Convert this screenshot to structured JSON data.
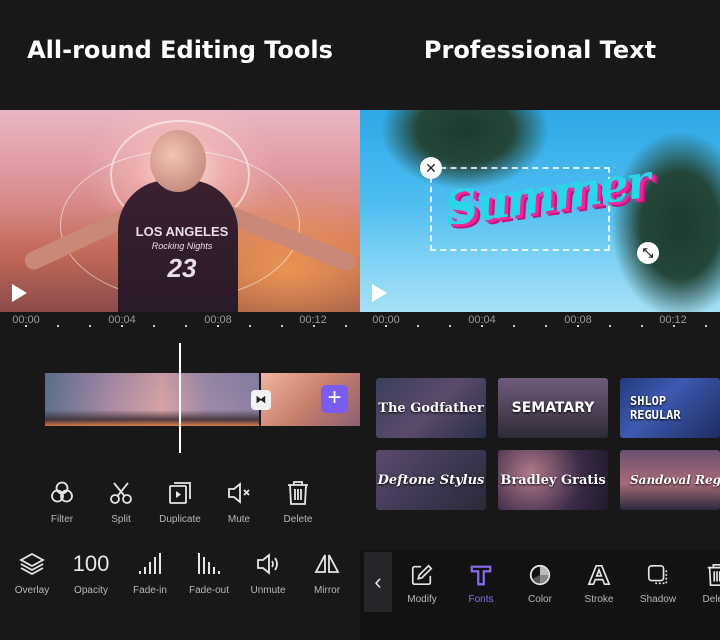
{
  "left_panel": {
    "headline": "All-round Editing Tools",
    "preview": {
      "jersey_line1": "LOS ANGELES",
      "jersey_line2": "Rocking Nights",
      "jersey_number": "23"
    },
    "ruler_labels": [
      "00:00",
      "00:04",
      "00:08",
      "00:12"
    ],
    "transition_icon": "bowtie-transition-icon",
    "add_clip_label": "+",
    "tools_row1": [
      {
        "label": "Filter",
        "icon": "filter-icon"
      },
      {
        "label": "Split",
        "icon": "scissors-icon"
      },
      {
        "label": "Duplicate",
        "icon": "duplicate-icon"
      },
      {
        "label": "Mute",
        "icon": "mute-icon"
      },
      {
        "label": "Delete",
        "icon": "trash-icon"
      }
    ],
    "tools_row2": [
      {
        "label": "Overlay",
        "icon": "layers-icon"
      },
      {
        "label": "Opacity",
        "value": "100"
      },
      {
        "label": "Fade-in",
        "icon": "fade-in-icon"
      },
      {
        "label": "Fade-out",
        "icon": "fade-out-icon"
      },
      {
        "label": "Unmute",
        "icon": "volume-icon"
      },
      {
        "label": "Mirror",
        "icon": "mirror-icon"
      }
    ]
  },
  "right_panel": {
    "headline": "Professional Text",
    "preview": {
      "overlay_text": "Summer",
      "close_glyph": "✕",
      "resize_glyph": "⤡"
    },
    "ruler_labels": [
      "00:00",
      "00:04",
      "00:08",
      "00:12"
    ],
    "fonts": [
      "The Godfather",
      "SEMATARY",
      "SHLOP REGULAR",
      "Deftone Stylus",
      "Bradley Gratis",
      "Sandoval Regular"
    ],
    "back_glyph": "‹",
    "tools": [
      {
        "label": "Modify",
        "icon": "edit-icon",
        "active": false
      },
      {
        "label": "Fonts",
        "icon": "font-t-icon",
        "active": true
      },
      {
        "label": "Color",
        "icon": "color-wheel-icon",
        "active": false
      },
      {
        "label": "Stroke",
        "icon": "stroke-a-icon",
        "active": false
      },
      {
        "label": "Shadow",
        "icon": "shadow-icon",
        "active": false
      },
      {
        "label": "Delete",
        "icon": "trash-icon",
        "active": false
      }
    ]
  },
  "colors": {
    "background": "#181818",
    "accent": "#7b5cf0",
    "active_label": "#8c6cf2",
    "summer_cyan": "#2ad6ea",
    "summer_pink": "#f0259a"
  }
}
